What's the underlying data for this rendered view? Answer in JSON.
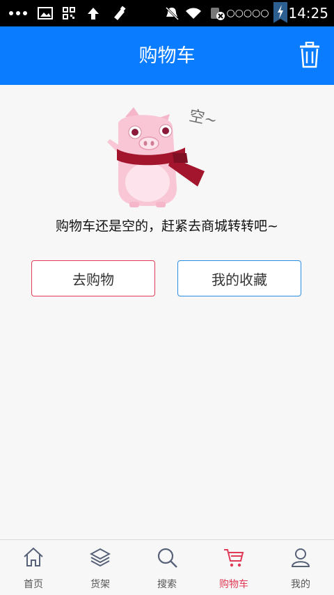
{
  "status_bar": {
    "time": "14:25",
    "signal_text": "○○○○○"
  },
  "header": {
    "title": "购物车"
  },
  "empty_state": {
    "message": "购物车还是空的，赶紧去商城转转吧~",
    "mascot_caption": "空~"
  },
  "actions": {
    "shop_label": "去购物",
    "favorites_label": "我的收藏"
  },
  "tabs": [
    {
      "label": "首页",
      "icon": "home-icon",
      "active": false
    },
    {
      "label": "货架",
      "icon": "layers-icon",
      "active": false
    },
    {
      "label": "搜索",
      "icon": "search-icon",
      "active": false
    },
    {
      "label": "购物车",
      "icon": "cart-icon",
      "active": true
    },
    {
      "label": "我的",
      "icon": "user-icon",
      "active": false
    }
  ],
  "colors": {
    "primary": "#0a7cff",
    "accent": "#e03a56",
    "secondary_border": "#2a8fe0"
  }
}
